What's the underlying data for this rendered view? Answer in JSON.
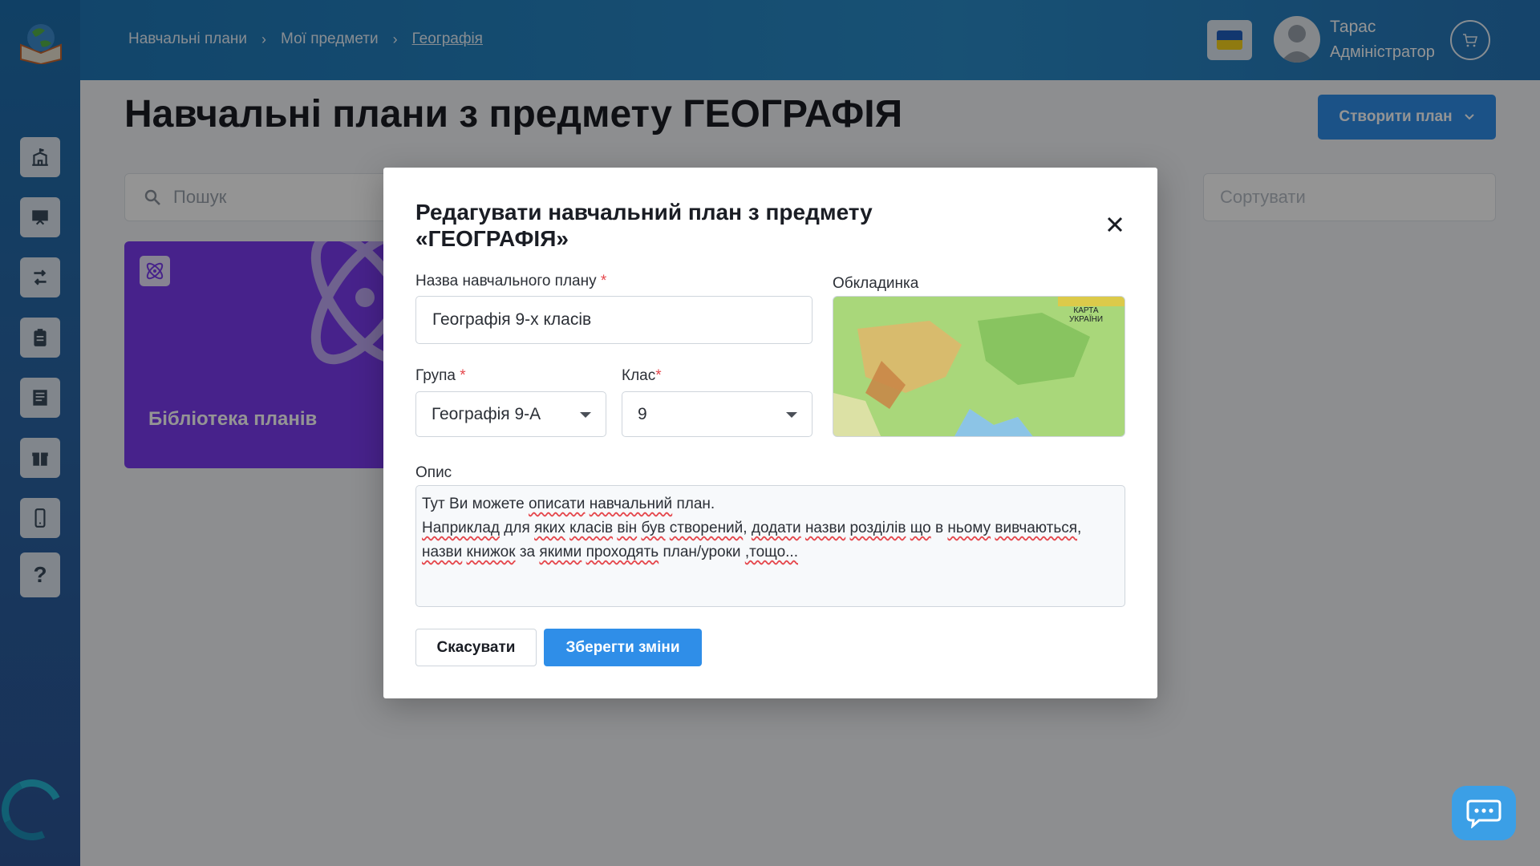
{
  "breadcrumbs": [
    "Навчальні плани",
    "Мої предмети",
    "Географія"
  ],
  "user": {
    "name": "Тарас",
    "role": "Адміністратор"
  },
  "page_title": "Навчальні плани з предмету ГЕОГРАФІЯ",
  "create_button": {
    "label": "Створити план"
  },
  "search": {
    "placeholder": "Пошук"
  },
  "sort": {
    "placeholder": "Сортувати"
  },
  "library_card": {
    "label": "Бібліотека планів"
  },
  "sidebar": {
    "items": [
      {
        "icon": "school-icon"
      },
      {
        "icon": "presentation-icon"
      },
      {
        "icon": "routes-icon"
      },
      {
        "icon": "clipboard-icon"
      },
      {
        "icon": "document-icon"
      },
      {
        "icon": "gift-icon"
      },
      {
        "icon": "mobile-icon"
      },
      {
        "icon": "help-icon",
        "label": "?"
      }
    ]
  },
  "modal": {
    "title": "Редагувати навчальний план з предмету «ГЕОГРАФІЯ»",
    "name_label": "Назва навчального плану",
    "name_value": "Географія 9-х класів",
    "cover_label": "Обкладинка",
    "cover_image_text": [
      "КАРТА",
      "УКРАЇНИ"
    ],
    "group_label": "Група",
    "group_value": "Географія 9-А",
    "class_label": "Клас",
    "class_value": "9",
    "description_label": "Опис",
    "description_lines": [
      "Тут Ви можете описати навчальний план.",
      "Наприклад для яких класів він був створений, додати назви розділів що в ньому вивчаються,",
      "назви книжок за якими проходять план/уроки ,тощо..."
    ],
    "cancel_label": "Скасувати",
    "save_label": "Зберегти зміни",
    "required_mark": "*"
  },
  "colors": {
    "primary": "#2f8ee8",
    "library_card": "#7b3cf0",
    "required": "#e5484d"
  }
}
